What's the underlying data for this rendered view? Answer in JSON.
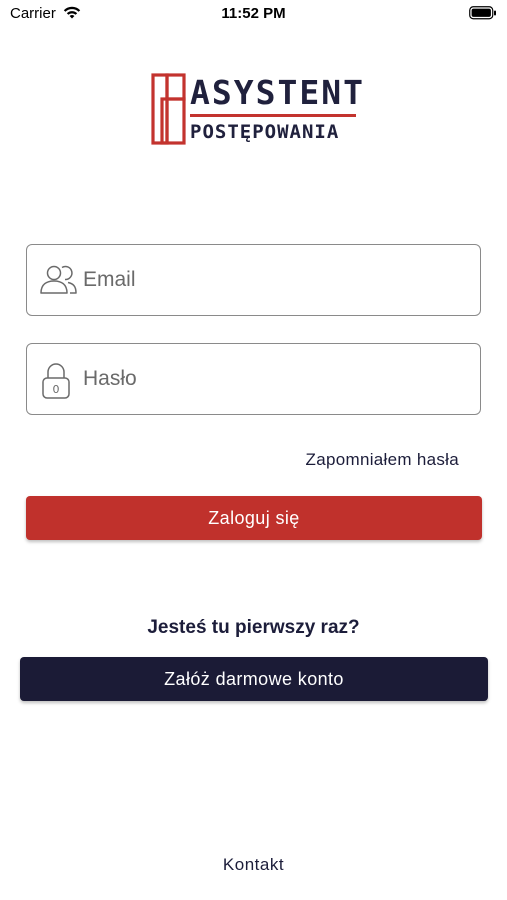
{
  "status_bar": {
    "carrier": "Carrier",
    "time": "11:52 PM",
    "icons": [
      "wifi-icon",
      "battery-icon"
    ]
  },
  "logo": {
    "line1": "ASYSTENT",
    "line2": "POSTĘPOWANIA",
    "colors": {
      "text": "#20213d",
      "accent": "#c3332e"
    }
  },
  "login_form": {
    "email": {
      "placeholder": "Email",
      "value": "",
      "icon": "users-icon"
    },
    "password": {
      "placeholder": "Hasło",
      "value": "",
      "icon": "padlock-icon"
    },
    "forgot_label": "Zapomniałem hasła",
    "login_button": "Zaloguj się"
  },
  "register": {
    "prompt": "Jesteś tu pierwszy raz?",
    "button": "Załóż darmowe konto"
  },
  "footer": {
    "contact": "Kontakt"
  },
  "colors": {
    "primary_red": "#c0312c",
    "navy": "#1b1b36",
    "text": "#1c1d3a"
  }
}
